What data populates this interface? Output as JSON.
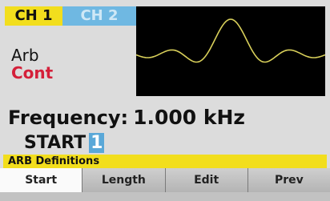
{
  "tabs": {
    "ch1_label": "CH 1",
    "ch2_label": "CH 2"
  },
  "mode": {
    "waveform": "Arb",
    "run_mode": "Cont"
  },
  "frequency": {
    "label": "Frequency:",
    "value": "1.000 kHz"
  },
  "start": {
    "label": "START",
    "value": "1"
  },
  "menu": {
    "title": "ARB Definitions",
    "softkeys": [
      "Start",
      "Length",
      "Edit",
      "Prev"
    ]
  },
  "colors": {
    "channel1": "#f2de1d",
    "channel2": "#6fb8e2",
    "trace": "#d8cf5a",
    "run_mode": "#d4203a"
  },
  "waveform_icon": "sinc-waveform"
}
